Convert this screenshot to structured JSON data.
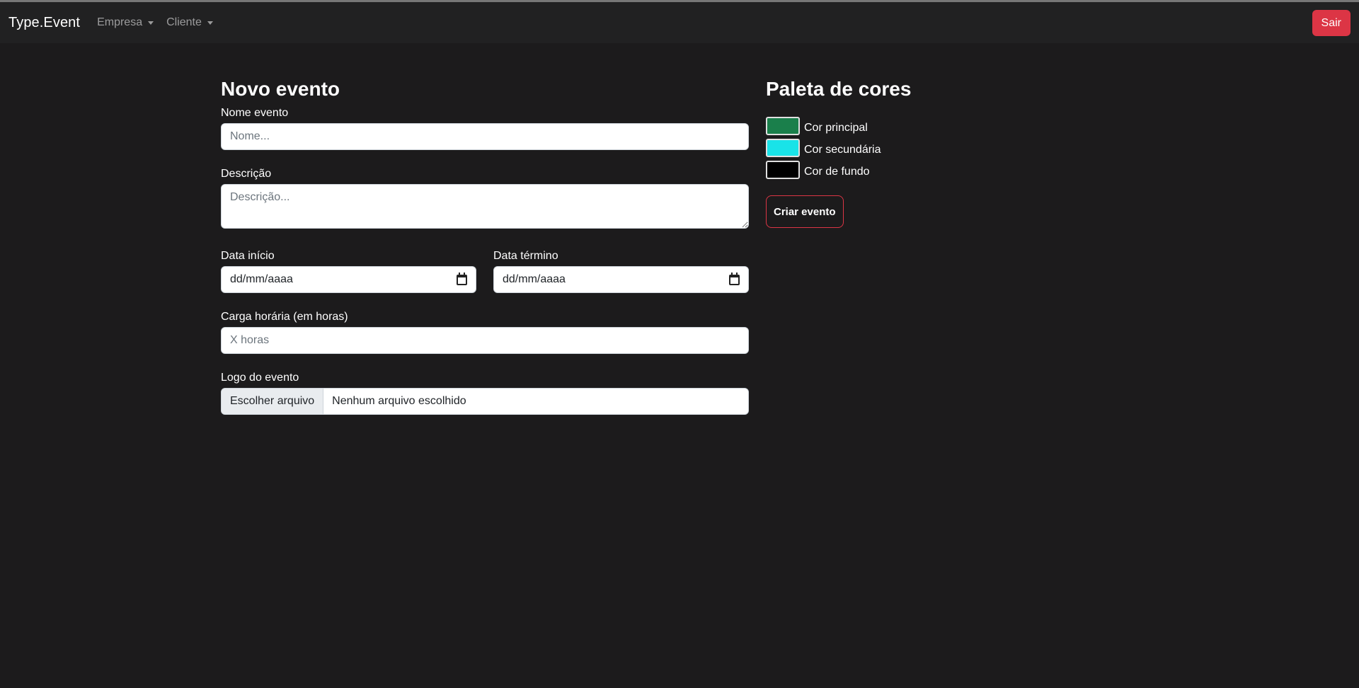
{
  "navbar": {
    "brand": "Type.Event",
    "menus": [
      "Empresa",
      "Cliente"
    ],
    "logout_label": "Sair"
  },
  "form": {
    "title": "Novo evento",
    "name": {
      "label": "Nome evento",
      "placeholder": "Nome..."
    },
    "description": {
      "label": "Descrição",
      "placeholder": "Descrição..."
    },
    "start_date": {
      "label": "Data início",
      "value": "dd/mm/aaaa"
    },
    "end_date": {
      "label": "Data término",
      "value": "dd/mm/aaaa"
    },
    "workload": {
      "label": "Carga horária (em horas)",
      "placeholder": "X horas"
    },
    "logo": {
      "label": "Logo do evento",
      "button": "Escolher arquivo",
      "status": "Nenhum arquivo escolhido"
    }
  },
  "palette": {
    "title": "Paleta de cores",
    "colors": [
      {
        "label": "Cor principal",
        "value": "#1a7f4b"
      },
      {
        "label": "Cor secundária",
        "value": "#19e3e8"
      },
      {
        "label": "Cor de fundo",
        "value": "#000000"
      }
    ],
    "submit_label": "Criar evento"
  },
  "theme": {
    "page_bg": "#1c1b1c",
    "navbar_bg": "#212122",
    "danger": "#dc3545"
  }
}
